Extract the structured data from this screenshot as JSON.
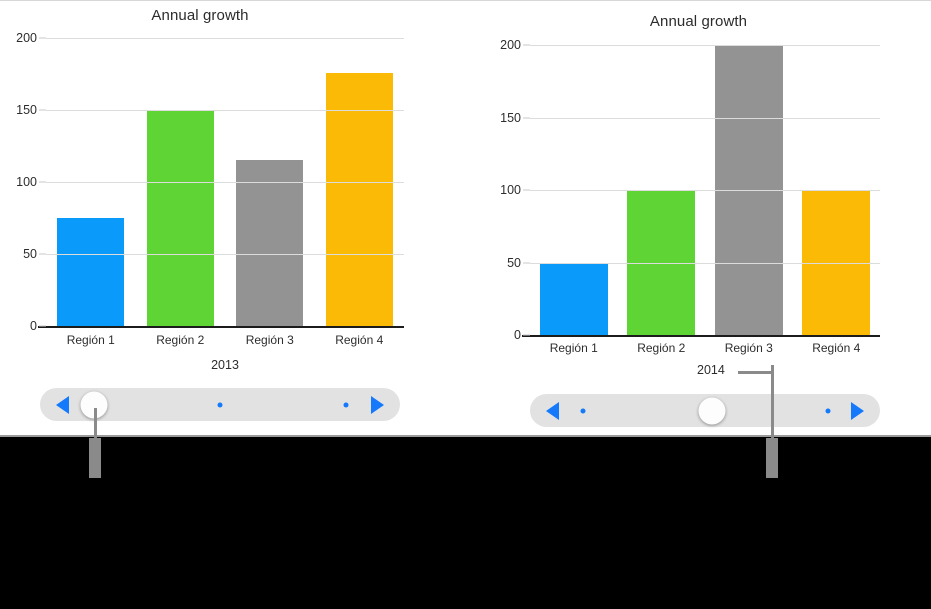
{
  "colors": {
    "blue": "#0a9afa",
    "green": "#5fd435",
    "gray": "#939393",
    "orange": "#fbba06",
    "accent": "#1479fb",
    "gridline": "#dcdcdc",
    "axis": "#1c1c1c",
    "slider_track": "#e2e2e2",
    "pointer": "#8a8a8a",
    "background": "#000000",
    "page": "#ffffff"
  },
  "left_panel": {
    "title": "Annual growth",
    "year_label": "2013",
    "slider": {
      "prev_label": "◀",
      "next_label": "▶",
      "thumb_position_pct": 15,
      "stops_pct": [
        15,
        50,
        85
      ]
    }
  },
  "right_panel": {
    "title": "Annual growth",
    "year_label": "2014",
    "slider": {
      "prev_label": "◀",
      "next_label": "▶",
      "thumb_position_pct": 52,
      "stops_pct": [
        15,
        52,
        85
      ]
    }
  },
  "chart_data": [
    {
      "type": "bar",
      "title": "Annual growth",
      "xlabel": "2013",
      "ylabel": "",
      "categories": [
        "Región 1",
        "Región 2",
        "Región 3",
        "Región 4"
      ],
      "values": [
        75,
        150,
        115,
        176
      ],
      "colors": [
        "#0a9afa",
        "#5fd435",
        "#939393",
        "#fbba06"
      ],
      "yticks": [
        0,
        50,
        100,
        150,
        200
      ],
      "ylim": [
        0,
        200
      ],
      "grid": true,
      "legend": "none"
    },
    {
      "type": "bar",
      "title": "Annual growth",
      "xlabel": "2014",
      "ylabel": "",
      "categories": [
        "Región 1",
        "Región 2",
        "Región 3",
        "Región 4"
      ],
      "values": [
        50,
        100,
        200,
        100
      ],
      "colors": [
        "#0a9afa",
        "#5fd435",
        "#939393",
        "#fbba06"
      ],
      "yticks": [
        0,
        50,
        100,
        150,
        200
      ],
      "ylim": [
        0,
        200
      ],
      "grid": true,
      "legend": "none"
    }
  ]
}
